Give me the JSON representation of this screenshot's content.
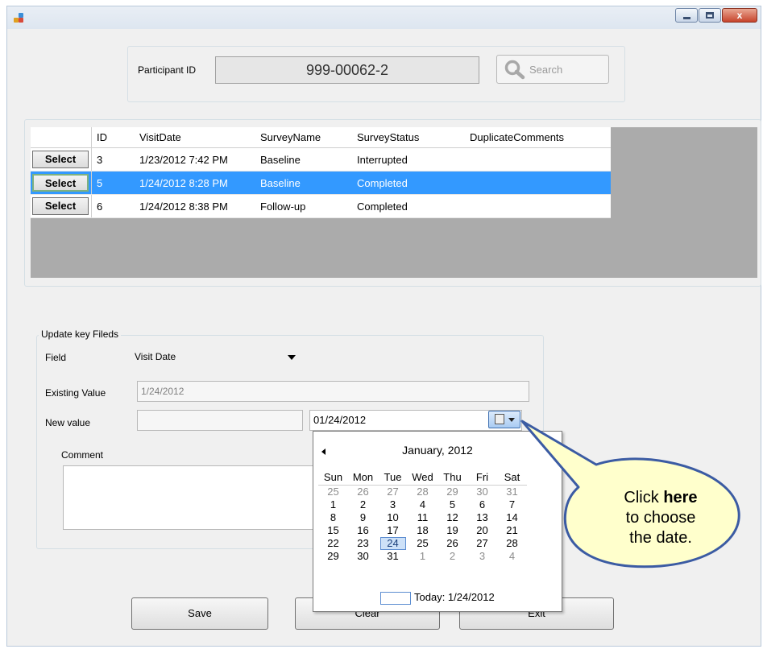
{
  "window": {
    "title": "",
    "close_glyph": "x",
    "colors": {
      "title_bg": "#dde6f0",
      "close_btn": "#c7442c",
      "selection": "#3399ff",
      "callout_fill": "#ffffcc",
      "callout_stroke": "#3b5ba3"
    }
  },
  "search_panel": {
    "participant_label": "Participant ID",
    "participant_value": "999-00062-2",
    "search_label": "Search",
    "search_icon": "magnifier-icon"
  },
  "grid": {
    "columns": [
      "",
      "ID",
      "VisitDate",
      "SurveyName",
      "SurveyStatus",
      "DuplicateComments"
    ],
    "select_label": "Select",
    "rows": [
      {
        "id": "3",
        "visit_date": "1/23/2012 7:42 PM",
        "survey_name": "Baseline",
        "survey_status": "Interrupted",
        "duplicate_comments": ""
      },
      {
        "id": "5",
        "visit_date": "1/24/2012 8:28 PM",
        "survey_name": "Baseline",
        "survey_status": "Completed",
        "duplicate_comments": "",
        "selected": true
      },
      {
        "id": "6",
        "visit_date": "1/24/2012 8:38 PM",
        "survey_name": "Follow-up",
        "survey_status": "Completed",
        "duplicate_comments": ""
      }
    ]
  },
  "update_group": {
    "title": "Update key Fileds",
    "field_label": "Field",
    "field_value": "Visit Date",
    "existing_label": "Existing Value",
    "existing_value": "1/24/2012",
    "new_value_label": "New value",
    "new_value_left": "",
    "new_value_date": "01/24/2012",
    "comment_label": "Comment",
    "comment_value": ""
  },
  "calendar": {
    "month_title": "January, 2012",
    "day_headers": [
      "Sun",
      "Mon",
      "Tue",
      "Wed",
      "Thu",
      "Fri",
      "Sat"
    ],
    "weeks": [
      [
        "25",
        "26",
        "27",
        "28",
        "29",
        "30",
        "31"
      ],
      [
        "1",
        "2",
        "3",
        "4",
        "5",
        "6",
        "7"
      ],
      [
        "8",
        "9",
        "10",
        "11",
        "12",
        "13",
        "14"
      ],
      [
        "15",
        "16",
        "17",
        "18",
        "19",
        "20",
        "21"
      ],
      [
        "22",
        "23",
        "24",
        "25",
        "26",
        "27",
        "28"
      ],
      [
        "29",
        "30",
        "31",
        "1",
        "2",
        "3",
        "4"
      ]
    ],
    "selected_day": "24",
    "today_text": "Today: 1/24/2012"
  },
  "callout": {
    "line1_pre": "Click ",
    "line1_bold": "here",
    "line2": "to choose",
    "line3": "the date."
  },
  "buttons": {
    "save": "Save",
    "clear": "Clear",
    "exit": "Exit"
  }
}
